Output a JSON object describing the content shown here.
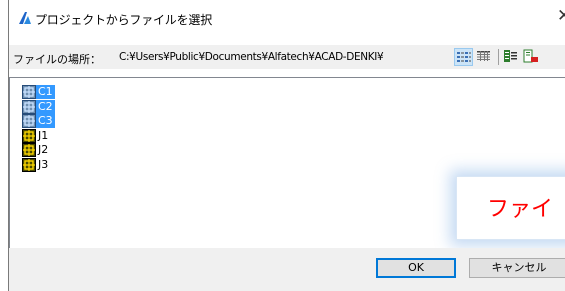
{
  "window": {
    "title": "プロジェクトからファイルを選択",
    "close": "✕"
  },
  "toolbar": {
    "location_label": "ファイルの場所：",
    "path": "C:¥Users¥Public¥Documents¥Alfatech¥ACAD-DENKI¥",
    "buttons": [
      {
        "icon": "list-view-icon",
        "active": true
      },
      {
        "icon": "details-view-icon",
        "active": false
      },
      {
        "icon": "properties-icon",
        "active": false
      },
      {
        "icon": "preview-icon",
        "active": false
      }
    ]
  },
  "files": [
    {
      "name": "C1",
      "selected": true
    },
    {
      "name": "C2",
      "selected": true
    },
    {
      "name": "C3",
      "selected": true
    },
    {
      "name": "J1",
      "selected": false
    },
    {
      "name": "J2",
      "selected": false
    },
    {
      "name": "J3",
      "selected": false
    }
  ],
  "background_window": {
    "text": "ファイ"
  },
  "footer": {
    "ok_label": "OK",
    "cancel_label": "キャンセル"
  },
  "colors": {
    "selection": "#3399ff",
    "accent": "#0078d7",
    "bg_text": "#ff0000"
  }
}
